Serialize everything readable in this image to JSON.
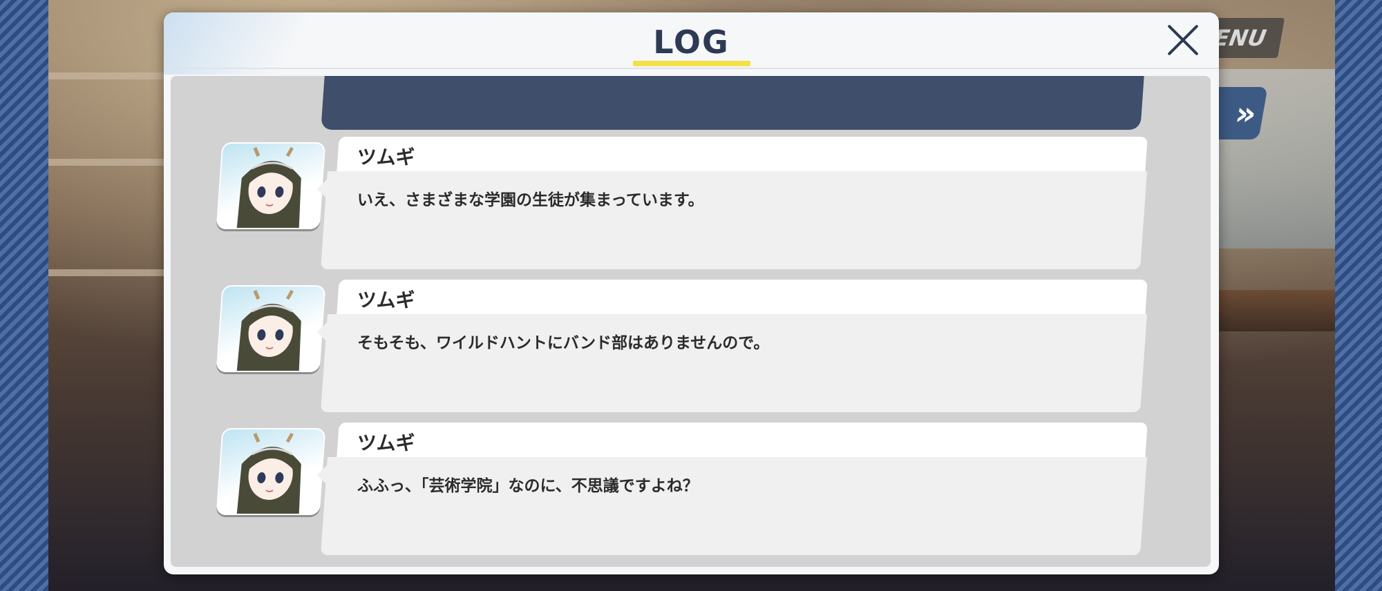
{
  "scene": {
    "menu_label": "ENU",
    "skip_label": "»"
  },
  "log": {
    "title": "LOG",
    "accent_color": "#f4e04a",
    "close_icon": "close-icon",
    "entries": [
      {
        "speaker": "ツムギ",
        "text": "いえ、さまざまな学園の生徒が集まっています。"
      },
      {
        "speaker": "ツムギ",
        "text": "そもそも、ワイルドハントにバンド部はありませんので。"
      },
      {
        "speaker": "ツムギ",
        "text": "ふふっ、「芸術学院」なのに、不思議ですよね？"
      }
    ]
  }
}
